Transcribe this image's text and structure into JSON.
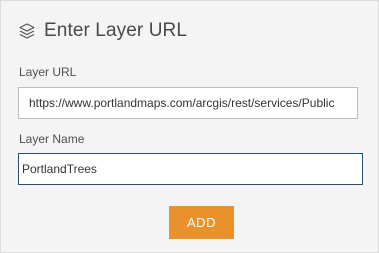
{
  "header": {
    "icon": "layers-icon",
    "title": "Enter Layer URL"
  },
  "form": {
    "url_label": "Layer URL",
    "url_value": "https://www.portlandmaps.com/arcgis/rest/services/Public",
    "name_label": "Layer Name",
    "name_value": "PortlandTrees",
    "add_label": "ADD"
  },
  "colors": {
    "accent": "#e8912d",
    "focus_border": "#2c4e6e",
    "panel_bg": "#f4f4f4"
  }
}
